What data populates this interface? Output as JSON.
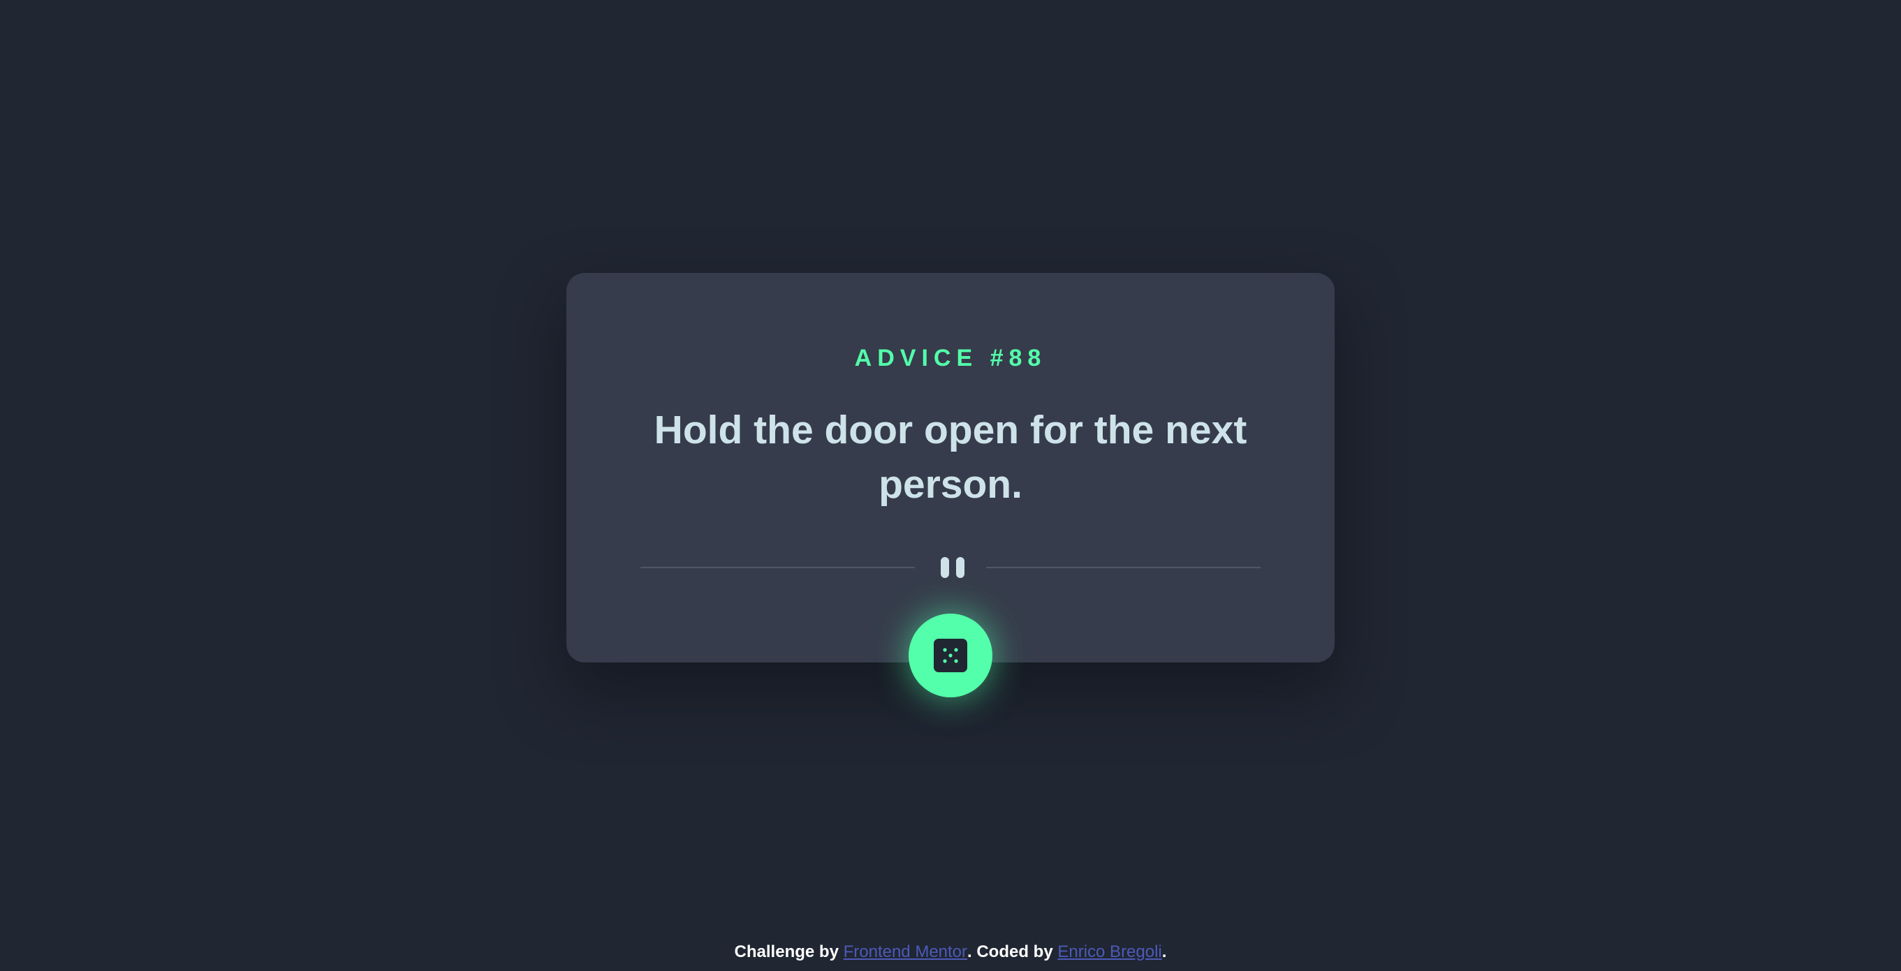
{
  "card": {
    "advice_label": "ADVICE #88",
    "advice_text": "Hold the door open for the next person."
  },
  "divider": {
    "icon": "pause-icon"
  },
  "dice_button": {
    "icon": "dice-icon"
  },
  "footer": {
    "prefix": "Challenge by ",
    "link1": "Frontend Mentor",
    "middle": ". Coded by ",
    "link2": "Enrico Bregoli",
    "suffix": "."
  },
  "colors": {
    "background": "#202632",
    "card": "#363c4b",
    "accent": "#53ffaa",
    "text": "#cee3e9",
    "link": "#4c5ab8"
  }
}
